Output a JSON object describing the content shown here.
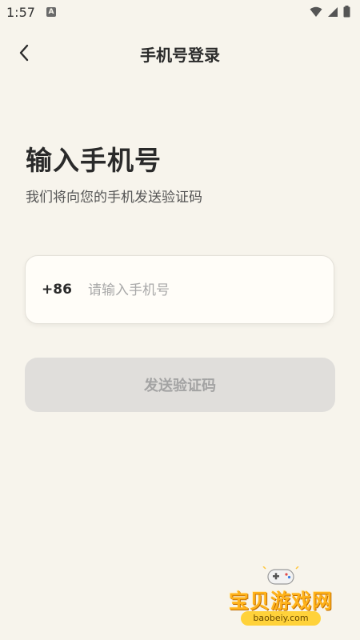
{
  "status_bar": {
    "time": "1:57",
    "notification_icon": "a-icon",
    "icons": [
      "wifi-icon",
      "signal-icon",
      "battery-icon"
    ]
  },
  "nav": {
    "back_icon": "chevron-left-icon",
    "title": "手机号登录"
  },
  "main": {
    "heading": "输入手机号",
    "subheading": "我们将向您的手机发送验证码",
    "phone_field": {
      "country_code": "+86",
      "value": "",
      "placeholder": "请输入手机号"
    },
    "send_button_label": "发送验证码"
  },
  "watermark": {
    "name": "宝贝游戏网",
    "url": "baobeiy.com",
    "icon": "gamepad-icon"
  },
  "colors": {
    "background": "#f7f4ec",
    "button_disabled_bg": "#e0dedb",
    "button_disabled_text": "#a3a3a3",
    "watermark_accent": "#ffb21a"
  }
}
